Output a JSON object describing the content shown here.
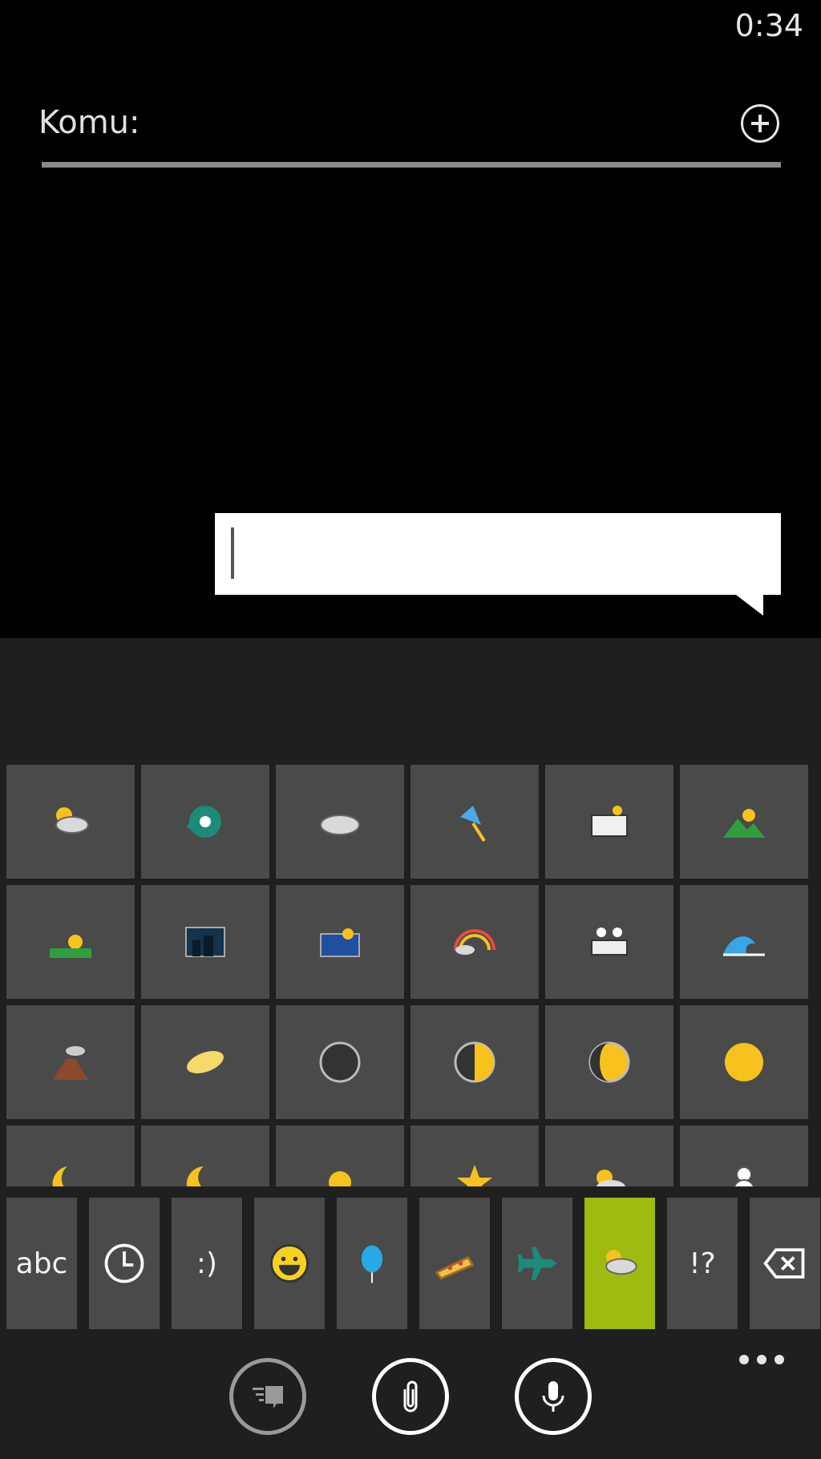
{
  "status": {
    "time": "0:34"
  },
  "recipient": {
    "label": "Komu:"
  },
  "compose": {
    "value": ""
  },
  "emoji_grid": [
    [
      "sun-behind-cloud-icon",
      "cyclone-icon",
      "cloud-icon",
      "umbrella-icon",
      "foggy-city-icon",
      "mountain-sunrise-icon"
    ],
    [
      "sunrise-icon",
      "night-city-icon",
      "city-sunset-icon",
      "rainbow-icon",
      "bridge-at-night-icon",
      "water-wave-icon"
    ],
    [
      "volcano-icon",
      "milky-way-icon",
      "new-moon-icon",
      "first-quarter-moon-icon",
      "waxing-gibbous-moon-icon",
      "full-moon-icon"
    ],
    [
      "crescent-moon-icon",
      "crescent-moon-face-icon",
      "sun-face-icon",
      "star-icon",
      "partly-cloudy-icon",
      "snowman-icon"
    ]
  ],
  "categories": [
    {
      "id": "abc",
      "label": "abc"
    },
    {
      "id": "recent",
      "icon": "clock-icon"
    },
    {
      "id": "text-smileys",
      "label": ":)"
    },
    {
      "id": "smileys",
      "icon": "smiley-icon"
    },
    {
      "id": "objects",
      "icon": "balloon-icon"
    },
    {
      "id": "food",
      "icon": "pizza-icon"
    },
    {
      "id": "travel",
      "icon": "airplane-icon"
    },
    {
      "id": "nature",
      "icon": "sun-behind-cloud-icon",
      "selected": true
    },
    {
      "id": "symbols",
      "label": "!?"
    },
    {
      "id": "backspace",
      "icon": "backspace-icon"
    }
  ],
  "appbar": {
    "buttons": [
      "conversation-icon",
      "attach-icon",
      "microphone-icon"
    ],
    "more": "more-dots-icon"
  },
  "colors": {
    "accent": "#9dbb11",
    "tile": "#4a4a4a",
    "keyboard_bg": "#1f1f1f"
  }
}
